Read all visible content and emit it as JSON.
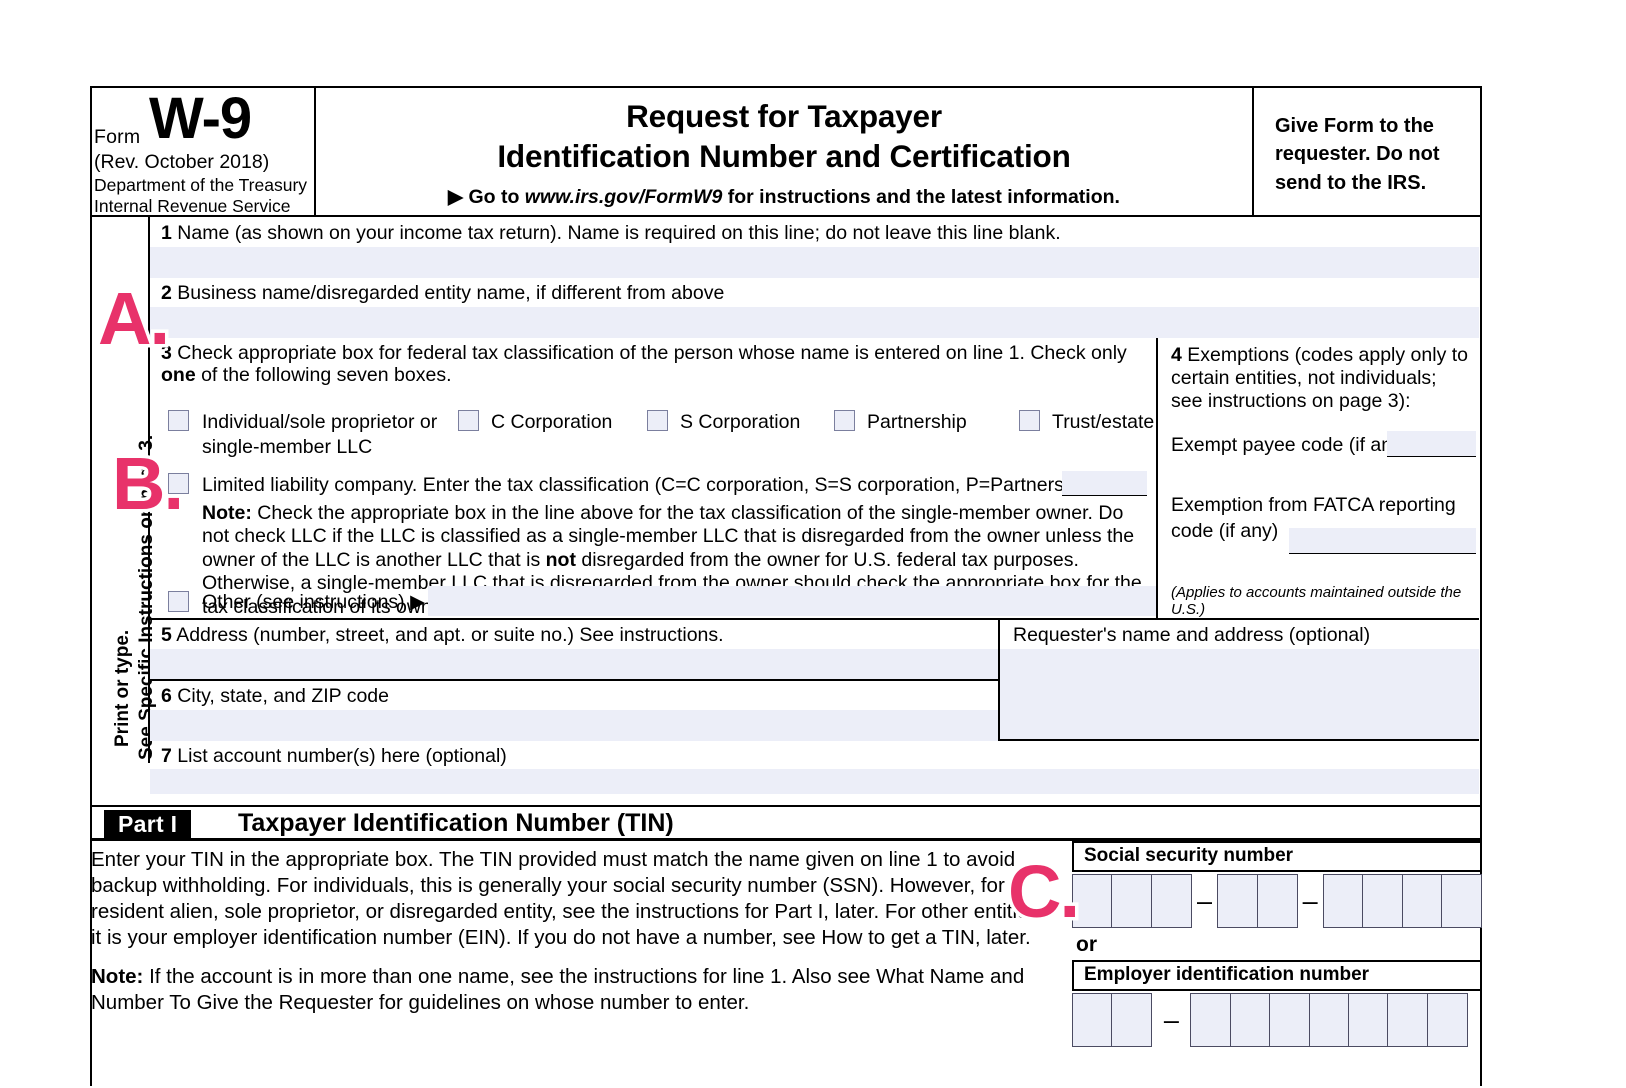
{
  "form": {
    "form_word": "Form",
    "form_number": "W-9",
    "revision": "(Rev. October 2018)",
    "department_line1": "Department of the Treasury",
    "department_line2": "Internal Revenue Service",
    "title_line1": "Request for Taxpayer",
    "title_line2": "Identification Number and Certification",
    "goto_prefix": "▶ Go to ",
    "goto_url": "www.irs.gov/FormW9",
    "goto_suffix": " for instructions and the latest information.",
    "give_form_note": "Give Form to the requester. Do not send to the IRS."
  },
  "rail": {
    "vertical_print": "Print or type.",
    "vertical_see": "See Specific Instructions on page 3."
  },
  "line1": {
    "number": "1",
    "caption": "Name (as shown on your income tax return). Name is required on this line; do not leave this line blank.",
    "value": ""
  },
  "line2": {
    "number": "2",
    "caption": "Business name/disregarded entity name, if different from above",
    "value": ""
  },
  "line3": {
    "number": "3",
    "intro": "Check appropriate box for federal tax classification of the person whose name is entered on line 1. Check only ",
    "intro_bold": "one",
    "intro_end": " of the following seven boxes.",
    "checkboxes": [
      {
        "id": "individual",
        "label_line1": "Individual/sole proprietor or",
        "label_line2": "single-member LLC",
        "checked": false
      },
      {
        "id": "c-corporation",
        "label": "C Corporation",
        "checked": false
      },
      {
        "id": "s-corporation",
        "label": "S Corporation",
        "checked": false
      },
      {
        "id": "partnership",
        "label": "Partnership",
        "checked": false
      },
      {
        "id": "trust-estate",
        "label": "Trust/estate",
        "checked": false
      }
    ],
    "llc": {
      "checked": false,
      "label": "Limited liability company. Enter the tax classification (C=C corporation, S=S corporation, P=Partnership) ▶",
      "value": ""
    },
    "note_bold": "Note:",
    "note_text": " Check the appropriate box in the line above for the tax classification of the single-member owner.  Do not check LLC if the LLC is classified as a single-member LLC that is disregarded from the owner unless the owner of the LLC is another LLC that is ",
    "note_bold2": "not",
    "note_text2": " disregarded from the owner for U.S. federal tax purposes. Otherwise, a single-member LLC that is disregarded from the owner should check the appropriate box for the tax classification of its owner.",
    "other": {
      "checked": false,
      "label": "Other (see instructions) ▶",
      "value": ""
    }
  },
  "line4": {
    "number": "4",
    "title": "Exemptions (codes apply only to certain entities, not individuals; see instructions on page 3):",
    "exempt_payee_label": "Exempt payee code (if any)",
    "exempt_payee_value": "",
    "fatca_label": "Exemption from FATCA reporting code (if any)",
    "fatca_value": "",
    "applies_note": "(Applies to accounts maintained outside the U.S.)"
  },
  "line5": {
    "number": "5",
    "caption": "Address (number, street, and apt. or suite no.) See instructions.",
    "value": ""
  },
  "line6": {
    "number": "6",
    "caption": "City, state, and ZIP code",
    "value": ""
  },
  "requester": {
    "caption": "Requester's name and address (optional)",
    "value": ""
  },
  "line7": {
    "number": "7",
    "caption": "List account number(s) here (optional)",
    "value": ""
  },
  "part1": {
    "tag": "Part I",
    "title": "Taxpayer Identification Number (TIN)",
    "body": "Enter your TIN in the appropriate box. The TIN provided must match the name given on line 1 to avoid backup withholding. For individuals, this is generally your social security number (SSN). However, for a resident alien, sole proprietor, or disregarded entity, see the instructions for Part I, later. For other entities, it is your employer identification number (EIN). If you do not have a number, see How to get a TIN, later.",
    "note_bold": "Note:",
    "note": " If the account is in more than one name, see the instructions for line 1. Also see What Name and Number To Give the Requester for guidelines on whose number to enter.",
    "ssn_label": "Social security number",
    "ssn_groups": [
      3,
      2,
      4
    ],
    "ssn_value": "",
    "or_word": "or",
    "ein_label": "Employer identification number",
    "ein_groups": [
      2,
      7
    ],
    "ein_value": "",
    "dash": "–"
  },
  "annotations": [
    {
      "id": "A",
      "label": "A.",
      "color": "#e8326a"
    },
    {
      "id": "B",
      "label": "B.",
      "color": "#e8326a"
    },
    {
      "id": "C",
      "label": "C.",
      "color": "#e8326a"
    }
  ],
  "colors": {
    "field_fill": "#eceef8",
    "field_border": "#7b7f9e",
    "annotation_pink": "#e8326a",
    "ink": "#000000"
  }
}
